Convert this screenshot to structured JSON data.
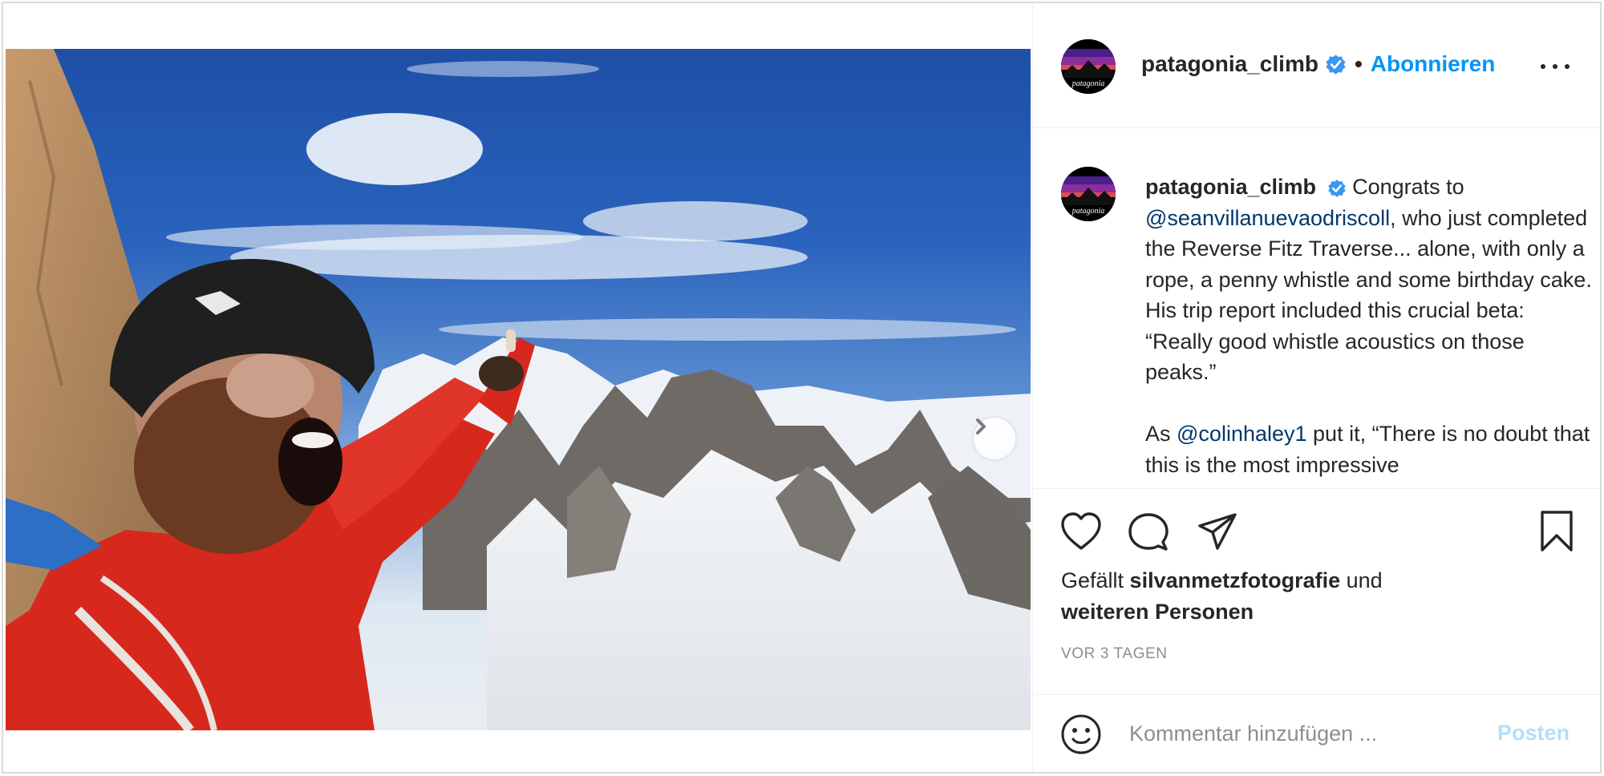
{
  "post": {
    "username": "patagonia_climb",
    "separator": "•",
    "follow_label": "Abonnieren",
    "avatar_text": "patagonia",
    "verified": true
  },
  "caption": {
    "username": "patagonia_climb",
    "parts": {
      "p1": " Congrats to ",
      "mention1": "@seanvillanuevaodriscoll",
      "p2": ", who just completed the Reverse Fitz Traverse... alone, with only a rope, a penny whistle and some birthday cake. His trip report included this crucial beta: “Really good whistle acoustics on those peaks.”",
      "p3": "As ",
      "mention2": "@colinhaley1",
      "p4": " put it, “There is no doubt that this is the most impressive"
    }
  },
  "likes": {
    "prefix": "Gefällt ",
    "user": "silvanmetzfotografie",
    "middle": " und ",
    "others": "weiteren Personen"
  },
  "timestamp": "VOR 3 TAGEN",
  "comment": {
    "placeholder": "Kommentar hinzufügen ...",
    "post_label": "Posten"
  },
  "carousel": {
    "slides": 2,
    "active": 0
  },
  "colors": {
    "link": "#0095f6",
    "mention": "#00376b",
    "verified": "#3897f0",
    "post_disabled": "#b2dffc",
    "muted": "#8e8e8e"
  },
  "icons": [
    "heart-icon",
    "comment-icon",
    "share-icon",
    "bookmark-icon",
    "emoji-icon",
    "chevron-right-icon",
    "more-icon",
    "verified-icon"
  ]
}
